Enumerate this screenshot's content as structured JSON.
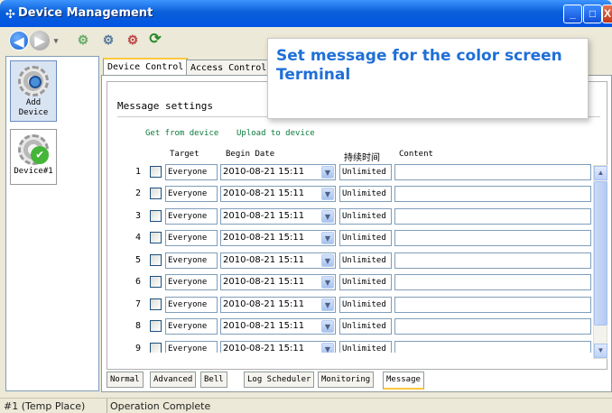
{
  "window": {
    "title": "Device Management",
    "min_glyph": "_",
    "max_glyph": "□",
    "close_glyph": "X"
  },
  "toolbar": {
    "back_glyph": "◀",
    "fwd_glyph": "▶",
    "sep_glyph": "▾",
    "refresh_glyph": "⟳"
  },
  "sidebar": {
    "add_label": "Add Device",
    "device_label": "Device#1",
    "ok_glyph": "✔"
  },
  "tabs": {
    "device_control": "Device Control",
    "access_control": "Access Control"
  },
  "tooltip": {
    "text": "Set message for the color screen Terminal"
  },
  "message": {
    "heading": "Message settings",
    "get_link": "Get from device",
    "upload_link": "Upload to device",
    "columns": {
      "target": "Target",
      "begin": "Begin Date",
      "duration": "持续时间",
      "content": "Content"
    },
    "dropdown_glyph": "▼",
    "rows": [
      {
        "num": "1",
        "target": "Everyone",
        "date": "2010-08-21 15:11",
        "duration": "Unlimited",
        "content": ""
      },
      {
        "num": "2",
        "target": "Everyone",
        "date": "2010-08-21 15:11",
        "duration": "Unlimited",
        "content": ""
      },
      {
        "num": "3",
        "target": "Everyone",
        "date": "2010-08-21 15:11",
        "duration": "Unlimited",
        "content": ""
      },
      {
        "num": "4",
        "target": "Everyone",
        "date": "2010-08-21 15:11",
        "duration": "Unlimited",
        "content": ""
      },
      {
        "num": "5",
        "target": "Everyone",
        "date": "2010-08-21 15:11",
        "duration": "Unlimited",
        "content": ""
      },
      {
        "num": "6",
        "target": "Everyone",
        "date": "2010-08-21 15:11",
        "duration": "Unlimited",
        "content": ""
      },
      {
        "num": "7",
        "target": "Everyone",
        "date": "2010-08-21 15:11",
        "duration": "Unlimited",
        "content": ""
      },
      {
        "num": "8",
        "target": "Everyone",
        "date": "2010-08-21 15:11",
        "duration": "Unlimited",
        "content": ""
      },
      {
        "num": "9",
        "target": "Everyone",
        "date": "2010-08-21 15:11",
        "duration": "Unlimited",
        "content": ""
      }
    ],
    "scroll_up_glyph": "▲",
    "scroll_down_glyph": "▼"
  },
  "bottom_tabs": [
    "Normal",
    "Advanced",
    "Bell",
    "Log Scheduler",
    "Monitoring",
    "Message"
  ],
  "status": {
    "place": "#1 (Temp Place)",
    "message": "Operation Complete"
  }
}
